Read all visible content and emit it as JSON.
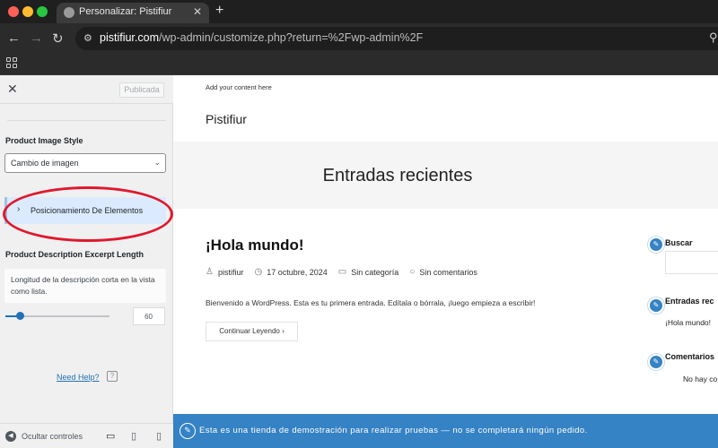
{
  "browser": {
    "tab_title": "Personalizar: Pistifiur",
    "url_host": "pistifiur.com",
    "url_path": "/wp-admin/customize.php?return=%2Fwp-admin%2F"
  },
  "sidebar": {
    "publish_label": "Publicada",
    "image_style_label": "Product Image Style",
    "image_style_value": "Cambio de imagen",
    "section_label": "Posicionamiento De Elementos",
    "excerpt_length_label": "Product Description Excerpt Length",
    "excerpt_length_description": "Longitud de la descripción corta en la vista como lista.",
    "excerpt_length_value": "60",
    "help_label": "Need Help?",
    "hide_controls_label": "Ocultar controles"
  },
  "preview": {
    "topbar_text": "Add your content here",
    "site_title": "Pistifiur",
    "hero_title": "Entradas recientes",
    "post": {
      "title": "¡Hola mundo!",
      "author": "pistifiur",
      "date": "17 octubre, 2024",
      "category": "Sin categoría",
      "comments": "Sin comentarios",
      "excerpt": "Bienvenido a WordPress. Esta es tu primera entrada. Edítala o bórrala, ¡luego empieza a escribir!",
      "read_more": "Continuar Leyendo"
    },
    "widgets": {
      "search_title": "Buscar",
      "recent_title": "Entradas rec",
      "recent_item": "¡Hola mundo!",
      "comments_title": "Comentarios",
      "comments_item": "No hay co"
    },
    "notice": "Esta es una tienda de demostración para realizar pruebas — no se completará ningún pedido."
  },
  "icons": {
    "close": "close-icon",
    "chevron_down": "chevron-down-icon",
    "chevron_right": "chevron-right-icon",
    "pencil": "pencil-icon"
  },
  "colors": {
    "accent": "#2271b1",
    "notice_bg": "#3582c4",
    "highlight": "#e0182d"
  }
}
